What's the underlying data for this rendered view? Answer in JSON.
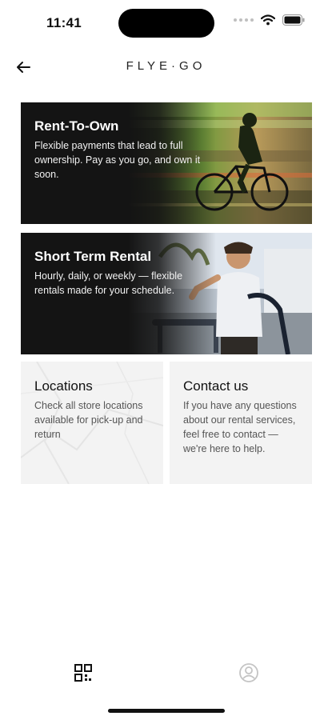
{
  "status": {
    "time": "11:41"
  },
  "header": {
    "logo": "FLYE·GO"
  },
  "cards": [
    {
      "title": "Rent-To-Own",
      "description": "Flexible payments that lead to full ownership. Pay as you go, and own it soon."
    },
    {
      "title": "Short Term Rental",
      "description": "Hourly, daily, or weekly — flexible rentals made for your schedule."
    }
  ],
  "tiles": [
    {
      "title": "Locations",
      "description": "Check all store locations available for pick-up and return"
    },
    {
      "title": "Contact us",
      "description": "If you have any questions about our rental services,  feel free to contact — we're here to help."
    }
  ],
  "icons": {
    "back": "arrow-left-icon",
    "tab_home": "qr-grid-icon",
    "tab_profile": "user-circle-icon",
    "wifi": "wifi-icon",
    "battery": "battery-icon"
  },
  "colors": {
    "card_dark": "#141414",
    "tile_bg": "#f3f3f3",
    "accent_green": "#8fd14f"
  }
}
